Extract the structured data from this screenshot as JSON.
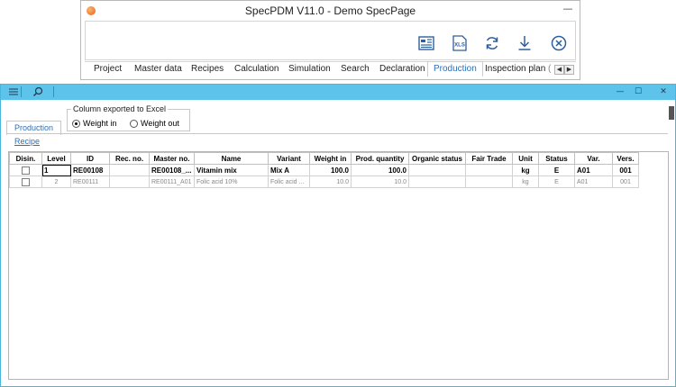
{
  "app": {
    "title": "SpecPDM V11.0 - Demo SpecPage",
    "minimize_glyph": "—",
    "ribbon_icons": [
      "report-icon",
      "excel-export-icon",
      "refresh-icon",
      "download-icon",
      "cancel-circle-icon"
    ],
    "excel_icon_text": "XLS",
    "menu": [
      "Project",
      "Master data",
      "Recipes",
      "Calculation",
      "Simulation",
      "Search",
      "Declaration",
      "Production",
      "Inspection plan",
      "("
    ],
    "active_menu": "Production",
    "scroll_left": "◀",
    "scroll_right": "▶"
  },
  "subwindow": {
    "toolbar_icons": [
      "menu-icon",
      "search-icon"
    ],
    "minimize_glyph": "—",
    "maximize_glyph": "☐",
    "close_glyph": "✕"
  },
  "content": {
    "tab_label": "Production",
    "export_group": {
      "legend": "Column exported to Excel",
      "options": [
        "Weight in",
        "Weight out"
      ],
      "selected": "Weight in"
    },
    "recipe_link": "Recipe"
  },
  "grid": {
    "columns": [
      "Disin.",
      "Level",
      "ID",
      "Rec. no.",
      "Master no.",
      "Name",
      "Variant",
      "Weight in",
      "Prod. quantity",
      "Organic status",
      "Fair Trade",
      "Unit",
      "Status",
      "Var.",
      "Vers."
    ],
    "rows": [
      {
        "disin": false,
        "level": "1",
        "id": "RE00108",
        "rec_no": "",
        "master_no": "RE00108_...",
        "name": "Vitamin mix",
        "variant": "Mix A",
        "weight_in": "100.0",
        "prod_quantity": "100.0",
        "organic_status": "",
        "fair_trade": "",
        "unit": "kg",
        "status": "E",
        "var": "A01",
        "vers": "001"
      },
      {
        "disin": false,
        "level": "2",
        "id": "RE00111",
        "rec_no": "",
        "master_no": "RE00111_A01",
        "name": "Folic acid 10%",
        "variant": "Folic acid ...",
        "weight_in": "10.0",
        "prod_quantity": "10.0",
        "organic_status": "",
        "fair_trade": "",
        "unit": "kg",
        "status": "E",
        "var": "A01",
        "vers": "001"
      }
    ]
  }
}
